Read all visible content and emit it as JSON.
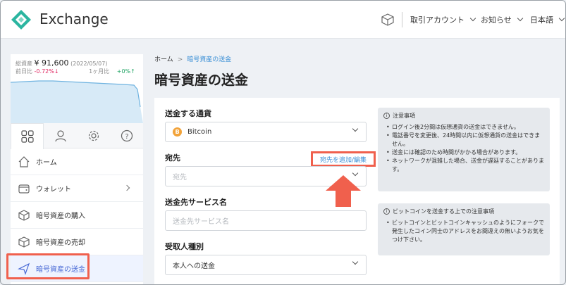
{
  "header": {
    "brand": "Exchange",
    "menu": [
      {
        "label": "取引アカウント"
      },
      {
        "label": "お知らせ"
      },
      {
        "label": "日本語"
      }
    ]
  },
  "sidebar": {
    "assets": {
      "total_label": "総資産",
      "total_value": "¥ 91,600",
      "date": "(2022/05/07)",
      "prev_day_label": "前日比",
      "prev_day_value": "-0.72%",
      "prev_day_arrow": "↓",
      "month_label": "1ヶ月比",
      "month_value": "+0%",
      "month_arrow": "↑"
    },
    "tabs": [
      {
        "icon": "grid-icon"
      },
      {
        "icon": "user-icon"
      },
      {
        "icon": "gear-icon"
      },
      {
        "icon": "help-icon"
      }
    ],
    "items": [
      {
        "label": "ホーム",
        "icon": "home-icon"
      },
      {
        "label": "ウォレット",
        "icon": "wallet-icon"
      },
      {
        "label": "暗号資産の購入",
        "icon": "cube-icon"
      },
      {
        "label": "暗号資産の売却",
        "icon": "cube-icon"
      },
      {
        "label": "暗号資産の送金",
        "icon": "send-icon"
      }
    ]
  },
  "breadcrumb": {
    "home": "ホーム",
    "sep": ">",
    "current": "暗号資産の送金"
  },
  "page_title": "暗号資産の送金",
  "form": {
    "currency_label": "送金する通貨",
    "currency_value": "Bitcoin",
    "currency_symbol": "B",
    "dest_label": "宛先",
    "dest_add_link": "宛先を追加/編集",
    "dest_placeholder": "宛先",
    "service_label": "送金先サービス名",
    "service_placeholder": "送金先サービス名",
    "recipient_label": "受取人種別",
    "recipient_value": "本人への送金"
  },
  "notes": [
    {
      "title": "注意事項",
      "items": [
        "ログイン後2分間は仮想通貨の送金はできません。",
        "電話番号を変更後、24時間以内に仮想通貨の送金はできません。",
        "送金には確認のため時間がかかる場合があります。",
        "ネットワークが混雑した場合、送金が遅延することがあります。"
      ]
    },
    {
      "title": "ビットコインを送金する上での注意事項",
      "items": [
        "ビットコインとビットコインキャッシュのようにフォークで発生したコイン同士のアドレスをお間違えの無いようお気をつけ下さい。"
      ]
    }
  ],
  "colors": {
    "accent": "#3a8fd6",
    "highlight": "#f0604d",
    "brand": "#2bb5a0"
  }
}
